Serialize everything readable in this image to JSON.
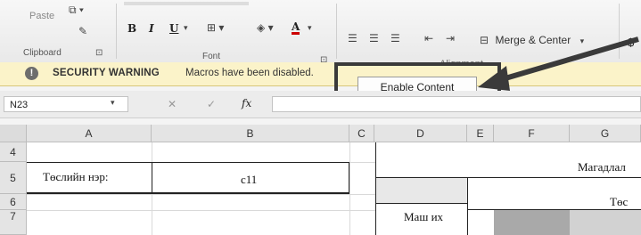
{
  "ribbon": {
    "clipboard": {
      "paste_label": "Paste",
      "group_label": "Clipboard",
      "launcher": "⊡"
    },
    "font": {
      "bold": "B",
      "italic": "I",
      "underline": "U",
      "group_label": "Font",
      "launcher": "⊡"
    },
    "alignment": {
      "merge_center_label": "Merge & Center",
      "group_label": "Alignment",
      "currency_symbol": "$"
    }
  },
  "security_bar": {
    "icon_glyph": "!",
    "title": "SECURITY WARNING",
    "message": "Macros have been disabled.",
    "button_label": "Enable Content"
  },
  "formula_bar": {
    "name_box": "N23",
    "cancel_glyph": "✕",
    "enter_glyph": "✓",
    "fx_label": "fx",
    "value": ""
  },
  "grid": {
    "columns": [
      "A",
      "B",
      "C",
      "D",
      "E",
      "F",
      "G"
    ],
    "rows": [
      "4",
      "5",
      "6",
      "7"
    ],
    "cells": {
      "A5": "Төслийн нэр:",
      "B5": "c11",
      "F4": "Магадлал",
      "G6": "Төс",
      "D7": "Маш их"
    }
  },
  "colors": {
    "security_bar_bg": "#fbf3c9",
    "callout_border": "#3a3a3a"
  }
}
